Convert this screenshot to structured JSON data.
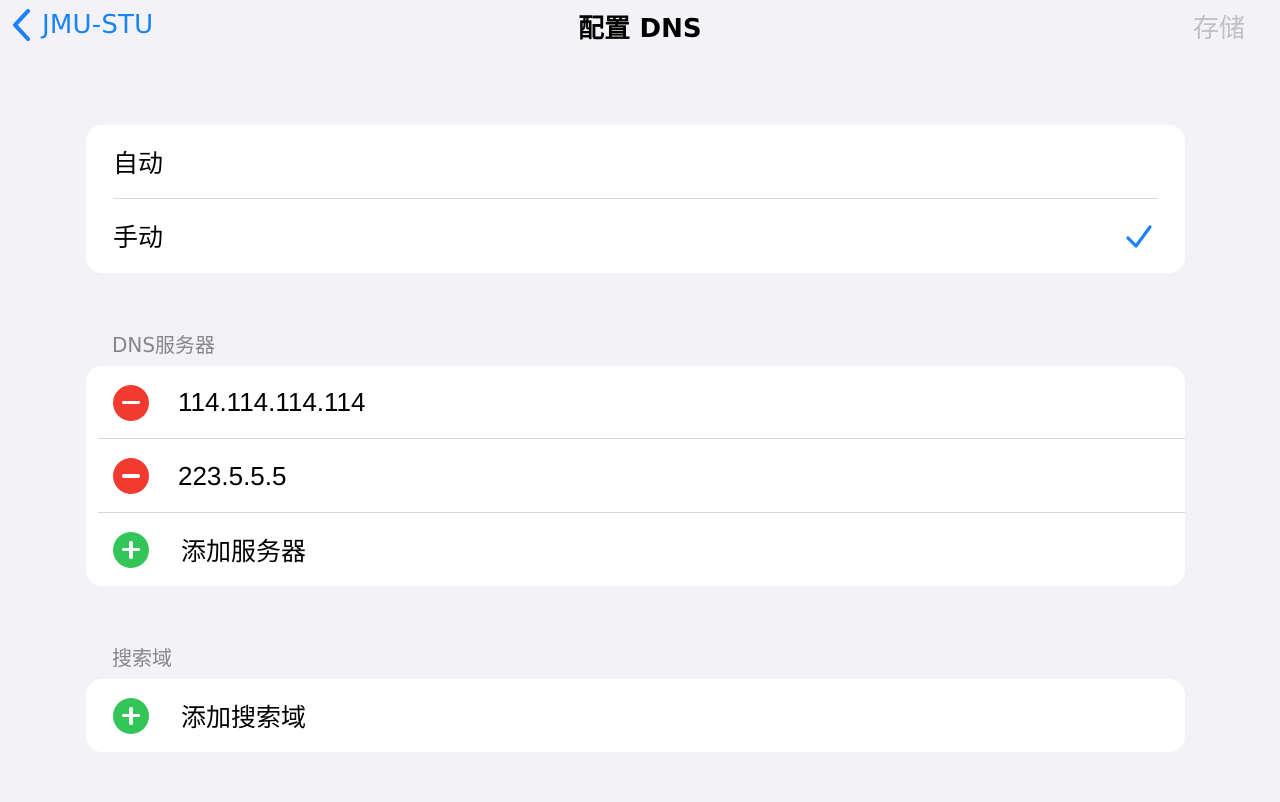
{
  "navbar": {
    "back_label": "JMU-STU",
    "title": "配置 DNS",
    "save_label": "存储"
  },
  "mode_options": [
    {
      "label": "自动",
      "selected": false
    },
    {
      "label": "手动",
      "selected": true
    }
  ],
  "dns_section": {
    "header": "DNS服务器",
    "servers": [
      "114.114.114.114",
      "223.5.5.5"
    ],
    "add_label": "添加服务器"
  },
  "search_section": {
    "header": "搜索域",
    "add_label": "添加搜索域"
  },
  "colors": {
    "accent": "#1a82fb",
    "remove": "#f23b30",
    "add": "#34c559",
    "background": "#f2f2f7"
  },
  "icons": [
    "chevron-left-icon",
    "checkmark-icon",
    "remove-circle-icon",
    "add-circle-icon"
  ]
}
